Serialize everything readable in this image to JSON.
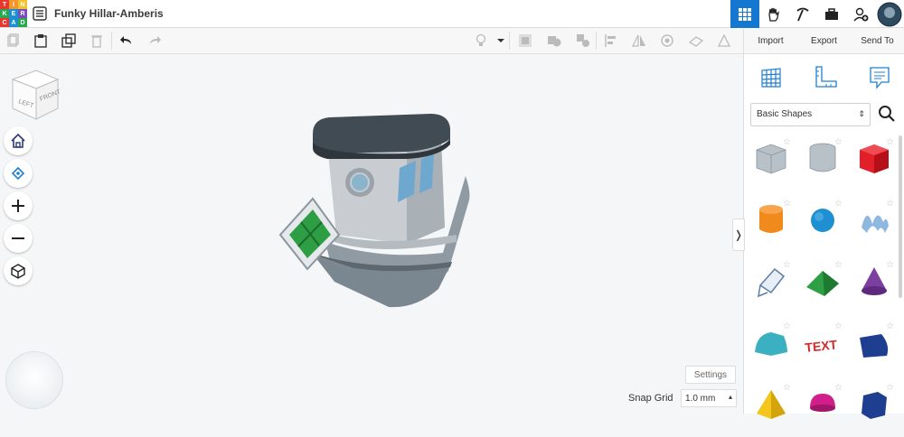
{
  "app": {
    "logo_letters": [
      "T",
      "I",
      "N",
      "K",
      "E",
      "R",
      "C",
      "A",
      "D"
    ],
    "logo_colors": [
      "#e8372c",
      "#f0962c",
      "#f3c32c",
      "#2aa84f",
      "#1d8ed6",
      "#7a4fbd",
      "#e8372c",
      "#1d8ed6",
      "#2aa84f"
    ],
    "project_title": "Funky Hillar-Amberis",
    "accent": "#1477d1"
  },
  "top_icons": [
    "grid-icon",
    "hand-icon",
    "pickaxe-icon",
    "briefcase-icon",
    "add-user-icon",
    "profile-avatar"
  ],
  "toolbar": {
    "left_tools": [
      "copy-icon",
      "paste-icon",
      "duplicate-icon",
      "delete-icon",
      "undo-icon",
      "redo-icon"
    ],
    "right_tools": [
      "light-bulb-icon",
      "dropdown-icon",
      "hole-icon",
      "solid-icon",
      "group-icon",
      "align-icon",
      "mirror-icon",
      "cruise-icon",
      "workplane-icon",
      "ruler-icon"
    ]
  },
  "panel": {
    "import_label": "Import",
    "export_label": "Export",
    "send_label": "Send To",
    "view_icons": [
      "workplane-grid-icon",
      "ruler-angle-icon",
      "notes-icon"
    ],
    "category": "Basic Shapes",
    "shapes": [
      {
        "name": "box-hole",
        "color": "#b8c0c8"
      },
      {
        "name": "cylinder-hole",
        "color": "#b8c0c8"
      },
      {
        "name": "box",
        "color": "#e3202a"
      },
      {
        "name": "cylinder",
        "color": "#f08a1c"
      },
      {
        "name": "sphere",
        "color": "#1e8fd0"
      },
      {
        "name": "scribble",
        "color": "#8fb8e0"
      },
      {
        "name": "shape-generator",
        "color": "#5a7ea8"
      },
      {
        "name": "roof",
        "color": "#2ea043"
      },
      {
        "name": "cone",
        "color": "#7b3fa0"
      },
      {
        "name": "round-roof",
        "color": "#3ab0c0"
      },
      {
        "name": "text",
        "color": "#d02b2b"
      },
      {
        "name": "half-cylinder",
        "color": "#1e3f90"
      },
      {
        "name": "pyramid",
        "color": "#f2c61a"
      },
      {
        "name": "sphere-half",
        "color": "#d01f8a"
      },
      {
        "name": "polygon",
        "color": "#1e3f90"
      }
    ]
  },
  "viewcube": {
    "left": "LEFT",
    "front": "FRONT"
  },
  "nav": [
    "home-view-icon",
    "fit-all-icon",
    "zoom-in-icon",
    "zoom-out-icon",
    "perspective-icon"
  ],
  "settings_label": "Settings",
  "snap_grid": {
    "label": "Snap Grid",
    "value": "1.0 mm"
  }
}
